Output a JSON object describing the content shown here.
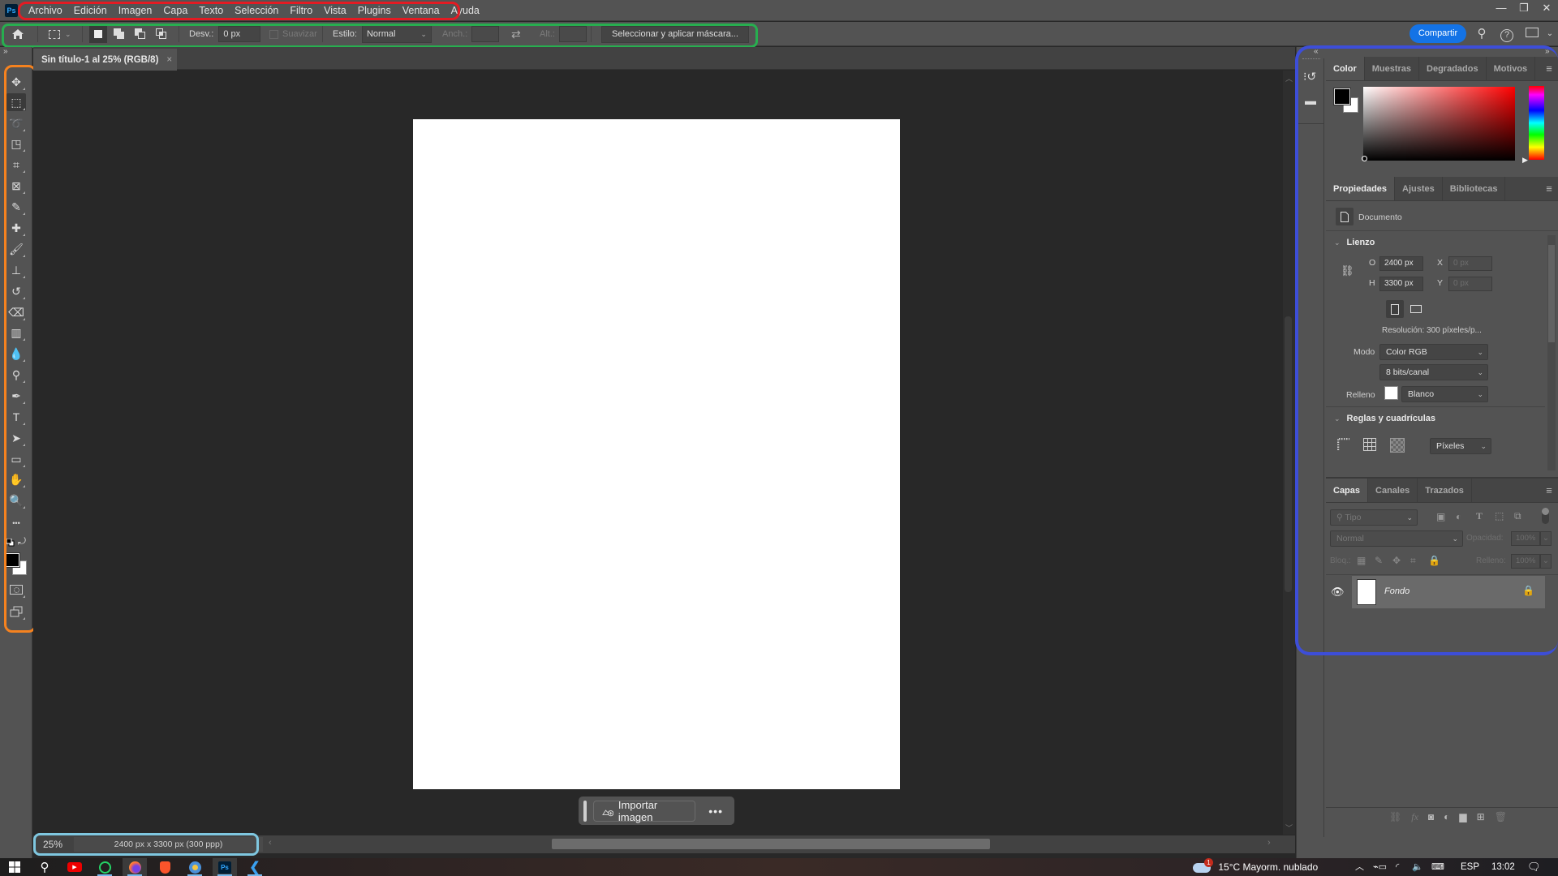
{
  "app": {
    "logo": "Ps",
    "menu": [
      "Archivo",
      "Edición",
      "Imagen",
      "Capa",
      "Texto",
      "Selección",
      "Filtro",
      "Vista",
      "Plugins",
      "Ventana",
      "Ayuda"
    ],
    "window_controls": {
      "minimize": "—",
      "restore": "❐",
      "close": "✕"
    }
  },
  "options_bar": {
    "home_icon": "home-icon",
    "tool_preset_icon": "rectangular-marquee-icon",
    "selection_modes": [
      "new-selection",
      "add-to-selection",
      "subtract-from-selection",
      "intersect-with-selection"
    ],
    "feather_label": "Desv.:",
    "feather_value": "0 px",
    "antialias_label": "Suavizar",
    "style_label": "Estilo:",
    "style_value": "Normal",
    "width_label": "Anch.:",
    "width_value": "",
    "height_label": "Alt.:",
    "height_value": "",
    "select_mask_label": "Seleccionar y aplicar máscara...",
    "share_label": "Compartir"
  },
  "toolbar": {
    "tools": [
      {
        "name": "move-tool",
        "glyph": "✥"
      },
      {
        "name": "rectangular-marquee-tool",
        "glyph": "⬚",
        "active": true
      },
      {
        "name": "lasso-tool",
        "glyph": "➰"
      },
      {
        "name": "object-selection-tool",
        "glyph": "◳"
      },
      {
        "name": "crop-tool",
        "glyph": "⌗"
      },
      {
        "name": "frame-tool",
        "glyph": "⊠"
      },
      {
        "name": "eyedropper-tool",
        "glyph": "✎"
      },
      {
        "name": "spot-healing-brush-tool",
        "glyph": "✚"
      },
      {
        "name": "brush-tool",
        "glyph": "🖌"
      },
      {
        "name": "clone-stamp-tool",
        "glyph": "⊥"
      },
      {
        "name": "history-brush-tool",
        "glyph": "↺"
      },
      {
        "name": "eraser-tool",
        "glyph": "⌫"
      },
      {
        "name": "gradient-tool",
        "glyph": "▥"
      },
      {
        "name": "blur-tool",
        "glyph": "💧"
      },
      {
        "name": "dodge-tool",
        "glyph": "⚲"
      },
      {
        "name": "pen-tool",
        "glyph": "✒"
      },
      {
        "name": "type-tool",
        "glyph": "T"
      },
      {
        "name": "path-selection-tool",
        "glyph": "➤"
      },
      {
        "name": "rectangle-tool",
        "glyph": "▭"
      },
      {
        "name": "hand-tool",
        "glyph": "✋"
      },
      {
        "name": "zoom-tool",
        "glyph": "🔍"
      },
      {
        "name": "edit-toolbar",
        "glyph": "•••"
      }
    ],
    "foreground_color": "#000000",
    "background_color": "#ffffff"
  },
  "document": {
    "tab_title": "Sin título-1 al 25% (RGB/8)",
    "close_glyph": "×",
    "zoom": "25%",
    "info": "2400 px x 3300 px (300 ppp)",
    "canvas_color": "#ffffff"
  },
  "context_bar": {
    "import_label": "Importar imagen",
    "more_glyph": "•••"
  },
  "color_panel": {
    "tabs": [
      "Color",
      "Muestras",
      "Degradados",
      "Motivos"
    ],
    "active_tab": "Color",
    "hue": "#ff0000"
  },
  "properties_panel": {
    "tabs": [
      "Propiedades",
      "Ajustes",
      "Bibliotecas"
    ],
    "active_tab": "Propiedades",
    "type_label": "Documento",
    "canvas_section": "Lienzo",
    "width_label": "O",
    "width_value": "2400 px",
    "height_label": "H",
    "height_value": "3300 px",
    "x_label": "X",
    "x_value": "0 px",
    "y_label": "Y",
    "y_value": "0 px",
    "resolution": "Resolución:  300  píxeles/p...",
    "mode_label": "Modo",
    "mode_value": "Color RGB",
    "depth_value": "8 bits/canal",
    "fill_label": "Relleno",
    "fill_value": "Blanco",
    "rulers_section": "Reglas y cuadrículas",
    "units_value": "Píxeles"
  },
  "layers_panel": {
    "tabs": [
      "Capas",
      "Canales",
      "Trazados"
    ],
    "active_tab": "Capas",
    "filter_placeholder": "Tipo",
    "blend_mode": "Normal",
    "opacity_label": "Opacidad:",
    "opacity_value": "100%",
    "lock_label": "Bloq.:",
    "fill_label": "Relleno:",
    "fill_value": "100%",
    "layers": [
      {
        "name": "Fondo",
        "visible": true,
        "locked": true
      }
    ]
  },
  "taskbar": {
    "apps": [
      "windows-start",
      "search",
      "youtube",
      "whatsapp",
      "firefox",
      "brave",
      "weather-app",
      "photoshop",
      "vscode"
    ],
    "weather_badge": "1",
    "weather": "15°C  Mayorm. nublado",
    "language": "ESP",
    "time": "13:02"
  }
}
